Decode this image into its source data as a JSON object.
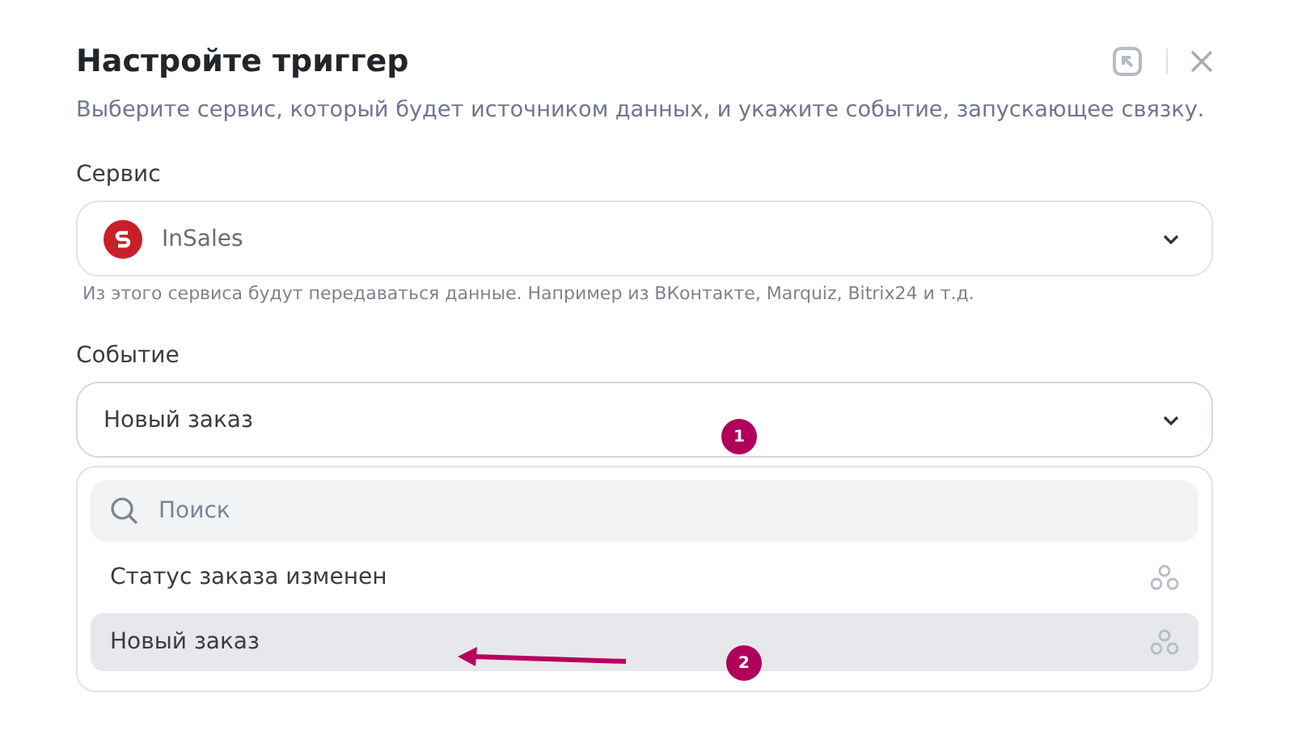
{
  "dialog": {
    "title": "Настройте триггер",
    "subtitle": "Выберите сервис, который будет источником данных, и укажите событие, запускающее связку."
  },
  "service": {
    "label": "Сервис",
    "value": "InSales",
    "hint": "Из этого сервиса будут передаваться данные. Например из ВКонтакте, Marquiz, Bitrix24 и т.д."
  },
  "event": {
    "label": "Событие",
    "value": "Новый заказ",
    "expanded": true,
    "search": {
      "placeholder": "Поиск"
    },
    "options": [
      {
        "label": "Статус заказа изменен",
        "selected": false
      },
      {
        "label": "Новый заказ",
        "selected": true
      }
    ]
  },
  "annotations": [
    {
      "label": "1"
    },
    {
      "label": "2"
    }
  ]
}
